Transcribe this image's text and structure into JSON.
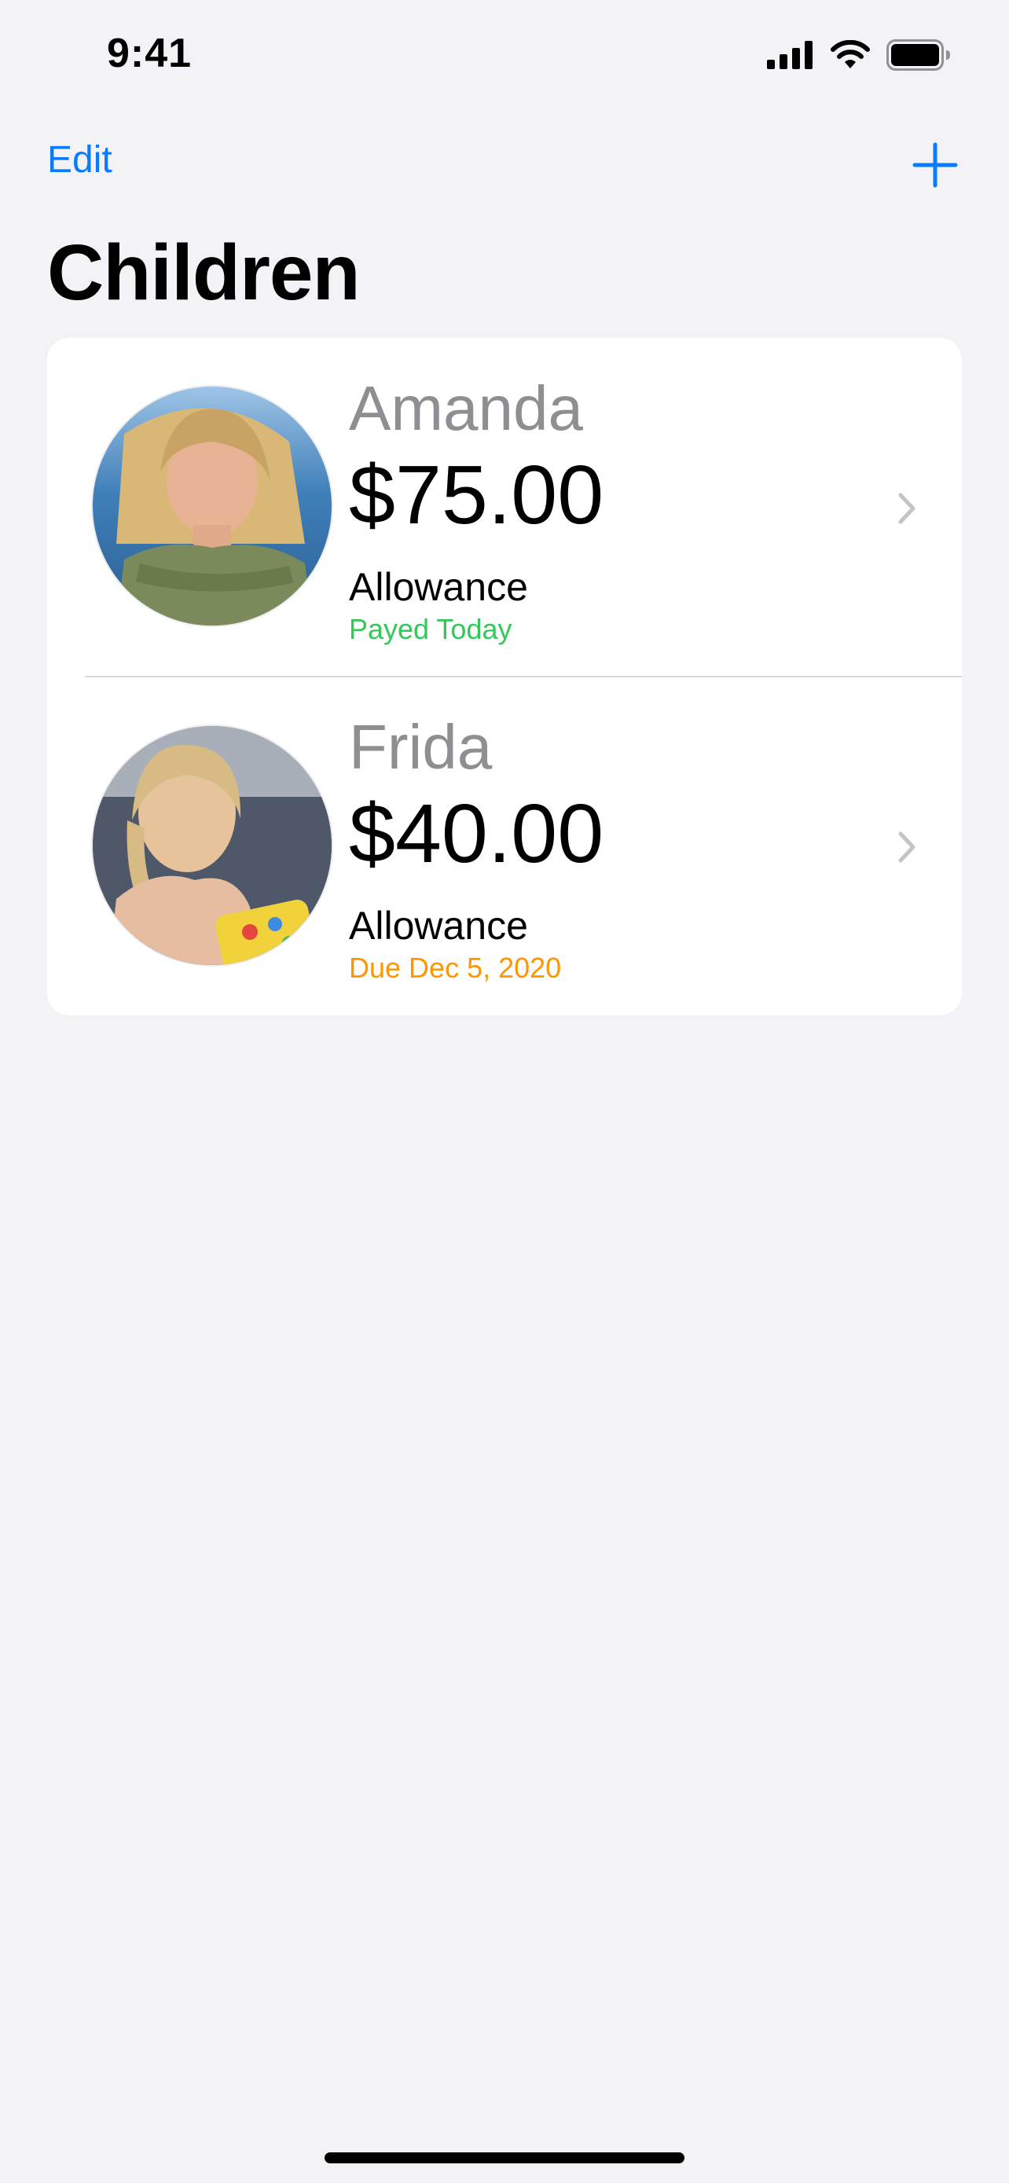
{
  "status_bar": {
    "time": "9:41",
    "icons": [
      "cellular-signal-icon",
      "wifi-icon",
      "battery-icon"
    ]
  },
  "nav": {
    "edit_label": "Edit",
    "add_icon": "plus-icon"
  },
  "page": {
    "title": "Children"
  },
  "children": [
    {
      "name": "Amanda",
      "balance": "$75.00",
      "allowance_label": "Allowance",
      "allowance_status": "Payed Today",
      "status_color": "#34c759"
    },
    {
      "name": "Frida",
      "balance": "$40.00",
      "allowance_label": "Allowance",
      "allowance_status": "Due Dec 5, 2020",
      "status_color": "#ff9500"
    }
  ],
  "colors": {
    "accent": "#0a7aff",
    "background": "#f2f2f7",
    "secondary_text": "#8e8e93"
  }
}
